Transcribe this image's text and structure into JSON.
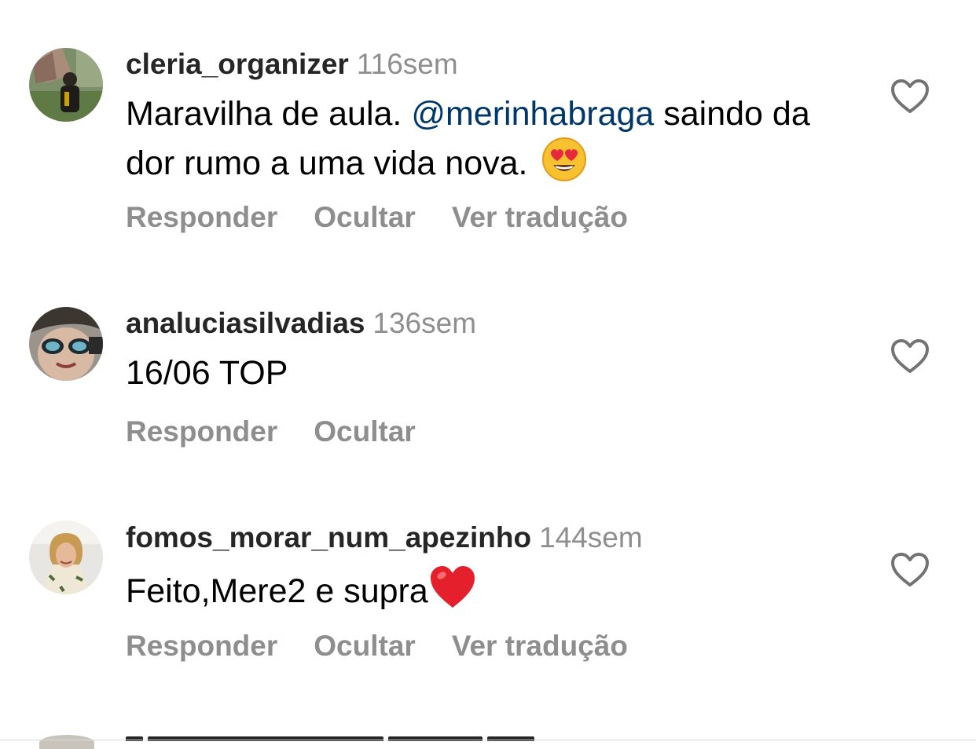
{
  "comments": [
    {
      "username": "cleria_organizer",
      "time": "116sem",
      "text_before": "Maravilha de aula. ",
      "mention": "@merinhabraga",
      "text_after": " saindo da dor rumo a uma vida nova.",
      "emoji": "heart-eyes-emoji",
      "actions": [
        "Responder",
        "Ocultar",
        "Ver tradução"
      ]
    },
    {
      "username": "analuciasilvadias",
      "time": "136sem",
      "text": "16/06 TOP",
      "actions": [
        "Responder",
        "Ocultar"
      ]
    },
    {
      "username": "fomos_morar_num_apezinho",
      "time": "144sem",
      "text": "Feito,Mere2 e supra",
      "emoji": "red-heart-emoji",
      "actions": [
        "Responder",
        "Ocultar",
        "Ver tradução"
      ]
    }
  ],
  "colors": {
    "secondary_text": "#8e8e8e",
    "mention": "#00376b",
    "username": "#262626"
  }
}
